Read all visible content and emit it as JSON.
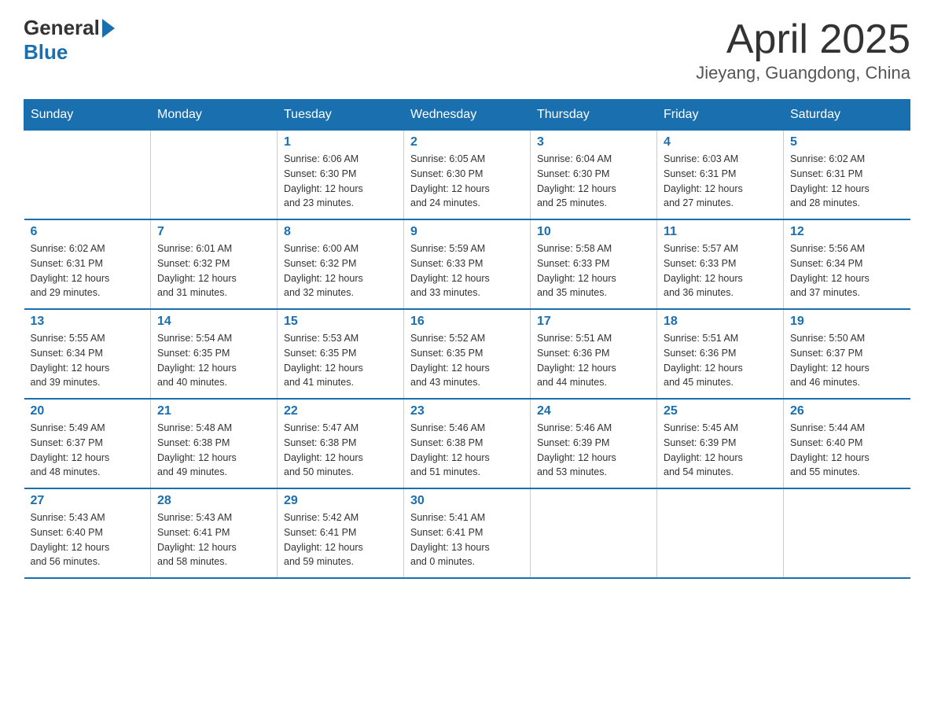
{
  "header": {
    "logo_general": "General",
    "logo_blue": "Blue",
    "month_title": "April 2025",
    "location": "Jieyang, Guangdong, China"
  },
  "weekdays": [
    "Sunday",
    "Monday",
    "Tuesday",
    "Wednesday",
    "Thursday",
    "Friday",
    "Saturday"
  ],
  "weeks": [
    [
      {
        "day": "",
        "info": ""
      },
      {
        "day": "",
        "info": ""
      },
      {
        "day": "1",
        "info": "Sunrise: 6:06 AM\nSunset: 6:30 PM\nDaylight: 12 hours\nand 23 minutes."
      },
      {
        "day": "2",
        "info": "Sunrise: 6:05 AM\nSunset: 6:30 PM\nDaylight: 12 hours\nand 24 minutes."
      },
      {
        "day": "3",
        "info": "Sunrise: 6:04 AM\nSunset: 6:30 PM\nDaylight: 12 hours\nand 25 minutes."
      },
      {
        "day": "4",
        "info": "Sunrise: 6:03 AM\nSunset: 6:31 PM\nDaylight: 12 hours\nand 27 minutes."
      },
      {
        "day": "5",
        "info": "Sunrise: 6:02 AM\nSunset: 6:31 PM\nDaylight: 12 hours\nand 28 minutes."
      }
    ],
    [
      {
        "day": "6",
        "info": "Sunrise: 6:02 AM\nSunset: 6:31 PM\nDaylight: 12 hours\nand 29 minutes."
      },
      {
        "day": "7",
        "info": "Sunrise: 6:01 AM\nSunset: 6:32 PM\nDaylight: 12 hours\nand 31 minutes."
      },
      {
        "day": "8",
        "info": "Sunrise: 6:00 AM\nSunset: 6:32 PM\nDaylight: 12 hours\nand 32 minutes."
      },
      {
        "day": "9",
        "info": "Sunrise: 5:59 AM\nSunset: 6:33 PM\nDaylight: 12 hours\nand 33 minutes."
      },
      {
        "day": "10",
        "info": "Sunrise: 5:58 AM\nSunset: 6:33 PM\nDaylight: 12 hours\nand 35 minutes."
      },
      {
        "day": "11",
        "info": "Sunrise: 5:57 AM\nSunset: 6:33 PM\nDaylight: 12 hours\nand 36 minutes."
      },
      {
        "day": "12",
        "info": "Sunrise: 5:56 AM\nSunset: 6:34 PM\nDaylight: 12 hours\nand 37 minutes."
      }
    ],
    [
      {
        "day": "13",
        "info": "Sunrise: 5:55 AM\nSunset: 6:34 PM\nDaylight: 12 hours\nand 39 minutes."
      },
      {
        "day": "14",
        "info": "Sunrise: 5:54 AM\nSunset: 6:35 PM\nDaylight: 12 hours\nand 40 minutes."
      },
      {
        "day": "15",
        "info": "Sunrise: 5:53 AM\nSunset: 6:35 PM\nDaylight: 12 hours\nand 41 minutes."
      },
      {
        "day": "16",
        "info": "Sunrise: 5:52 AM\nSunset: 6:35 PM\nDaylight: 12 hours\nand 43 minutes."
      },
      {
        "day": "17",
        "info": "Sunrise: 5:51 AM\nSunset: 6:36 PM\nDaylight: 12 hours\nand 44 minutes."
      },
      {
        "day": "18",
        "info": "Sunrise: 5:51 AM\nSunset: 6:36 PM\nDaylight: 12 hours\nand 45 minutes."
      },
      {
        "day": "19",
        "info": "Sunrise: 5:50 AM\nSunset: 6:37 PM\nDaylight: 12 hours\nand 46 minutes."
      }
    ],
    [
      {
        "day": "20",
        "info": "Sunrise: 5:49 AM\nSunset: 6:37 PM\nDaylight: 12 hours\nand 48 minutes."
      },
      {
        "day": "21",
        "info": "Sunrise: 5:48 AM\nSunset: 6:38 PM\nDaylight: 12 hours\nand 49 minutes."
      },
      {
        "day": "22",
        "info": "Sunrise: 5:47 AM\nSunset: 6:38 PM\nDaylight: 12 hours\nand 50 minutes."
      },
      {
        "day": "23",
        "info": "Sunrise: 5:46 AM\nSunset: 6:38 PM\nDaylight: 12 hours\nand 51 minutes."
      },
      {
        "day": "24",
        "info": "Sunrise: 5:46 AM\nSunset: 6:39 PM\nDaylight: 12 hours\nand 53 minutes."
      },
      {
        "day": "25",
        "info": "Sunrise: 5:45 AM\nSunset: 6:39 PM\nDaylight: 12 hours\nand 54 minutes."
      },
      {
        "day": "26",
        "info": "Sunrise: 5:44 AM\nSunset: 6:40 PM\nDaylight: 12 hours\nand 55 minutes."
      }
    ],
    [
      {
        "day": "27",
        "info": "Sunrise: 5:43 AM\nSunset: 6:40 PM\nDaylight: 12 hours\nand 56 minutes."
      },
      {
        "day": "28",
        "info": "Sunrise: 5:43 AM\nSunset: 6:41 PM\nDaylight: 12 hours\nand 58 minutes."
      },
      {
        "day": "29",
        "info": "Sunrise: 5:42 AM\nSunset: 6:41 PM\nDaylight: 12 hours\nand 59 minutes."
      },
      {
        "day": "30",
        "info": "Sunrise: 5:41 AM\nSunset: 6:41 PM\nDaylight: 13 hours\nand 0 minutes."
      },
      {
        "day": "",
        "info": ""
      },
      {
        "day": "",
        "info": ""
      },
      {
        "day": "",
        "info": ""
      }
    ]
  ]
}
